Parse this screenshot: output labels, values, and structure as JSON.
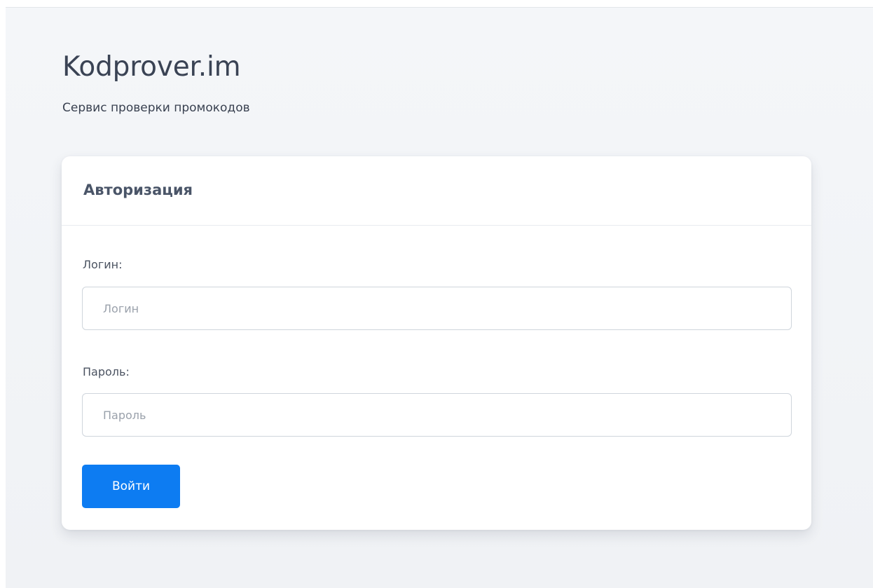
{
  "header": {
    "title": "Kodprover.im",
    "subtitle": "Сервис проверки промокодов"
  },
  "auth_card": {
    "title": "Авторизация",
    "login": {
      "label": "Логин:",
      "placeholder": "Логин",
      "value": ""
    },
    "password": {
      "label": "Пароль:",
      "placeholder": "Пароль",
      "value": ""
    },
    "submit_label": "Войти"
  },
  "colors": {
    "page_background": "#f2f4f7",
    "card_background": "#ffffff",
    "accent": "#0d7cf2",
    "title_text": "#3a4354"
  }
}
